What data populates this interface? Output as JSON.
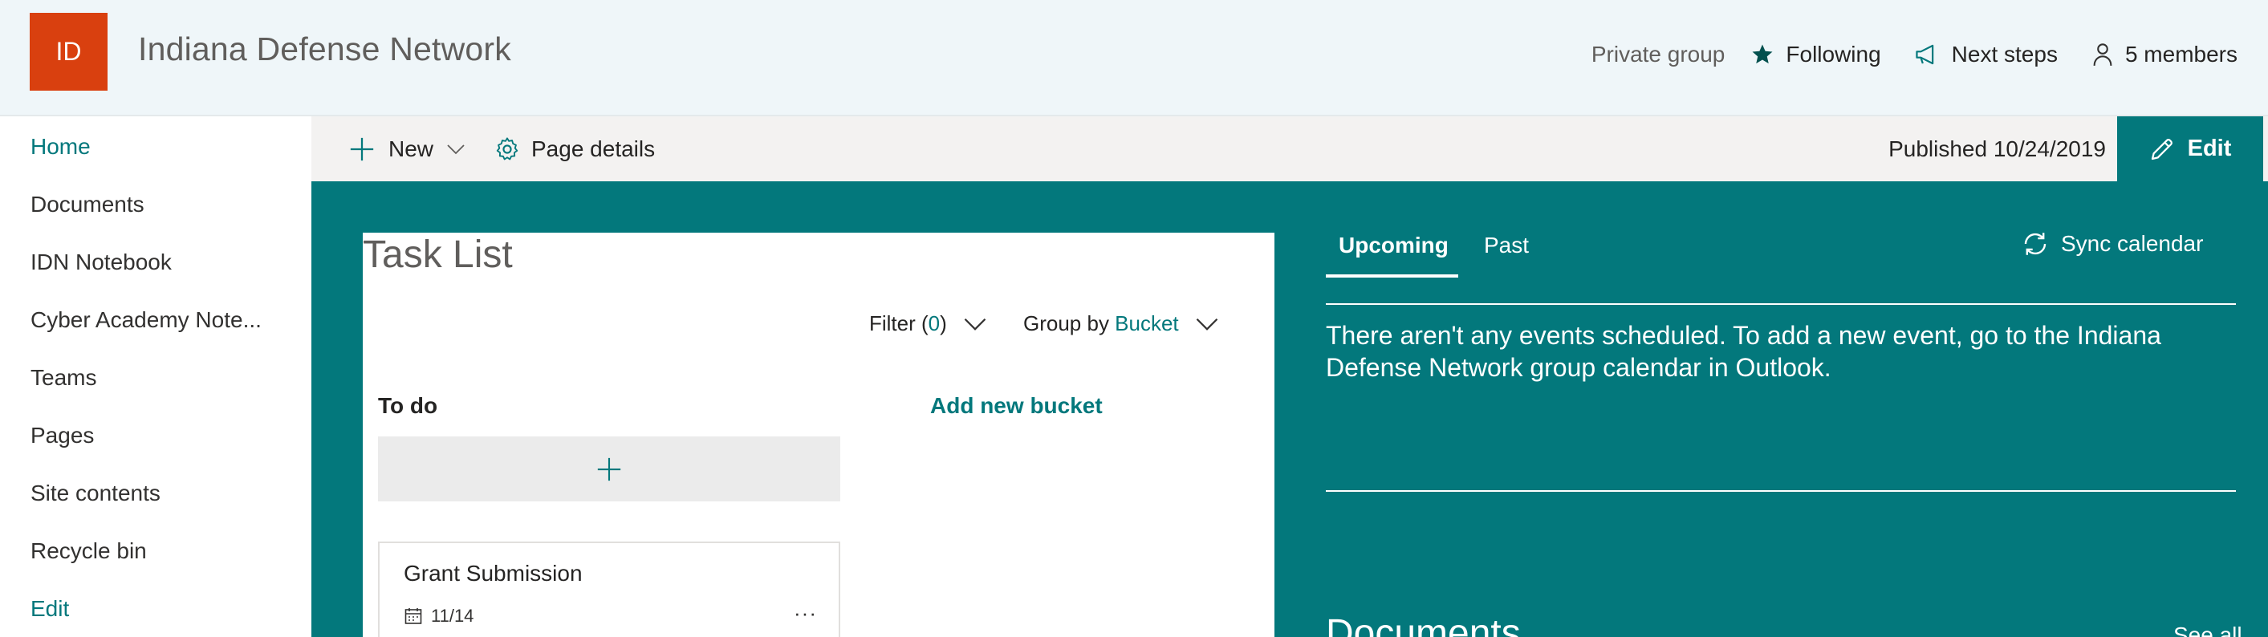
{
  "header": {
    "logo_text": "ID",
    "site_title": "Indiana Defense Network",
    "privacy": "Private group",
    "following": "Following",
    "next_steps": "Next steps",
    "members": "5 members"
  },
  "nav": {
    "items": [
      {
        "label": "Home"
      },
      {
        "label": "Documents"
      },
      {
        "label": "IDN Notebook"
      },
      {
        "label": "Cyber Academy Note..."
      },
      {
        "label": "Teams"
      },
      {
        "label": "Pages"
      },
      {
        "label": "Site contents"
      },
      {
        "label": "Recycle bin"
      },
      {
        "label": "Edit"
      }
    ]
  },
  "commandbar": {
    "new_label": "New",
    "page_details_label": "Page details",
    "published": "Published 10/24/2019",
    "edit_label": "Edit"
  },
  "tasklist": {
    "title": "Task List",
    "filter_label": "Filter (",
    "filter_count": "0",
    "filter_close": ")",
    "groupby_label": "Group by ",
    "groupby_value": "Bucket",
    "bucket_name": "To do",
    "add_bucket": "Add new bucket",
    "task": {
      "name": "Grant Submission",
      "date": "11/14",
      "more": "···"
    }
  },
  "events": {
    "tab_upcoming": "Upcoming",
    "tab_past": "Past",
    "sync": "Sync calendar",
    "message": "There aren't any events scheduled. To add a new event, go to the Indiana Defense Network group calendar in Outlook."
  },
  "documents": {
    "title": "Documents",
    "see_all": "See all"
  },
  "colors": {
    "accent": "#03787c",
    "logo": "#d9400f",
    "header_bg": "#eff6f9",
    "commandbar_bg": "#f3f2f1"
  },
  "icons": [
    "star-icon",
    "megaphone-icon",
    "person-icon",
    "plus-icon",
    "chevron-down-icon",
    "gear-icon",
    "pencil-icon",
    "calendar-icon",
    "sync-icon"
  ]
}
